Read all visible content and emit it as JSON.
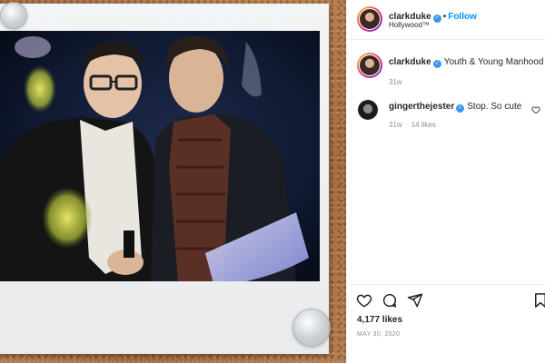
{
  "post": {
    "author": {
      "username": "clarkduke",
      "verified": true,
      "follow_label": "Follow",
      "location": "Hollywood™"
    },
    "caption": {
      "username": "clarkduke",
      "text": "Youth & Young Manhood",
      "time_ago": "31w"
    },
    "comments": [
      {
        "username": "ginger the jester",
        "display_username": "gingerthejester",
        "verified": true,
        "text": "Stop. So cute",
        "time_ago": "31w",
        "likes": "14 likes"
      }
    ],
    "likes": "4,177 likes",
    "date": "MAY 30, 2020"
  },
  "icons": {
    "like": "heart-icon",
    "comment": "comment-bubble-icon",
    "share": "paper-plane-icon",
    "save": "bookmark-icon",
    "verified": "verified-badge-icon"
  },
  "colors": {
    "link_blue": "#0095f6",
    "verified_blue": "#3897f0",
    "muted_text": "#8e8e8e",
    "border": "#efefef",
    "cork": "#b07a4e"
  }
}
